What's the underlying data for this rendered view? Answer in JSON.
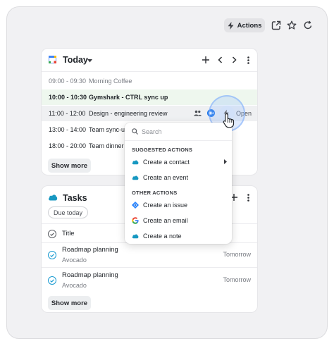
{
  "toolbar": {
    "actions_label": "Actions",
    "icons": [
      "bolt-icon",
      "share-icon",
      "star-icon",
      "refresh-icon"
    ]
  },
  "today": {
    "title": "Today",
    "icons": [
      "calendar-logo-icon",
      "chevron-down-icon",
      "plus-icon",
      "chevron-left-icon",
      "chevron-right-icon",
      "more-vertical-icon"
    ],
    "events": [
      {
        "time": "09:00 - 09:30",
        "title": "Morning Coffee",
        "state": "past"
      },
      {
        "time": "10:00 - 10:30",
        "title": "Gymshark - CTRL sync up",
        "state": "current"
      },
      {
        "time": "11:00 - 12:00",
        "title": "Design - engineering review",
        "state": "hover",
        "open_label": "Open"
      },
      {
        "time": "13:00 - 14:00",
        "title": "Team sync-up",
        "state": "normal"
      },
      {
        "time": "18:00 - 20:00",
        "title": "Team dinner a",
        "state": "normal"
      }
    ],
    "show_more_label": "Show more"
  },
  "tasks": {
    "title": "Tasks",
    "filter_label": "Due today",
    "header_label": "Title",
    "items": [
      {
        "title": "Roadmap planning",
        "subtitle": "Avocado",
        "due": "Tomorrow"
      },
      {
        "title": "Roadmap planning",
        "subtitle": "Avocado",
        "due": "Tomorrow"
      }
    ],
    "show_more_label": "Show more"
  },
  "popup": {
    "search_placeholder": "Search",
    "suggested_header": "SUGGESTED ACTIONS",
    "suggested": [
      {
        "label": "Create a contact",
        "icon": "salesforce-cloud-icon",
        "has_submenu": true
      },
      {
        "label": "Create an event",
        "icon": "salesforce-cloud-icon"
      }
    ],
    "other_header": "OTHER ACTIONS",
    "other": [
      {
        "label": "Create an issue",
        "icon": "jira-diamond-icon"
      },
      {
        "label": "Create an email",
        "icon": "google-g-icon"
      },
      {
        "label": "Create a note",
        "icon": "salesforce-cloud-icon"
      }
    ]
  },
  "colors": {
    "accent_blue": "#1a8cdc",
    "salesforce_blue": "#1798c1",
    "current_row_bg": "#eef7ee",
    "check_teal": "#1a9bd1"
  }
}
